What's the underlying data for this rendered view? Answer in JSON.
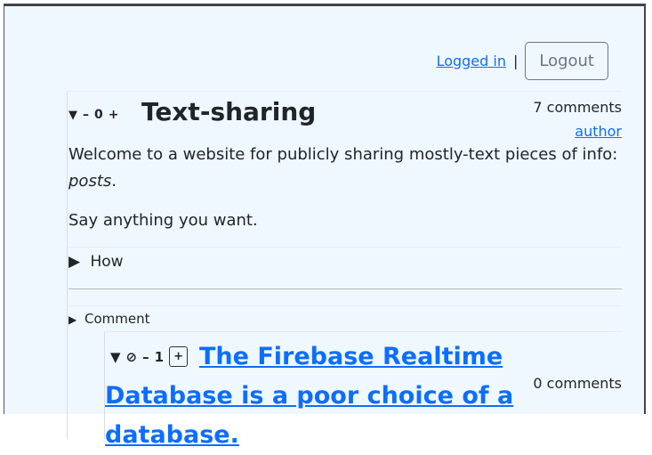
{
  "header": {
    "logged_in": "Logged in",
    "separator": "|",
    "logout": "Logout"
  },
  "post": {
    "collapse_icon": "▼",
    "minus": "–",
    "score": "0",
    "plus": "+",
    "title": "Text-sharing",
    "comments": "7 comments",
    "author": "author",
    "para1a": "Welcome to a website for publicly sharing mostly-text pieces of info:",
    "para1b": "posts",
    "para1c": ".",
    "para2": "Say anything you want.",
    "how": "How",
    "comment": "Comment"
  },
  "subpost": {
    "collapse_icon": "▼",
    "block_icon": "⃠",
    "minus": "–",
    "score": "1",
    "plus": "+",
    "title": "The Firebase Realtime Database is a poor choice of a database.",
    "comments": "0 comments"
  },
  "colors": {
    "link": "#0d6efd",
    "background": "#f0f8ff"
  }
}
